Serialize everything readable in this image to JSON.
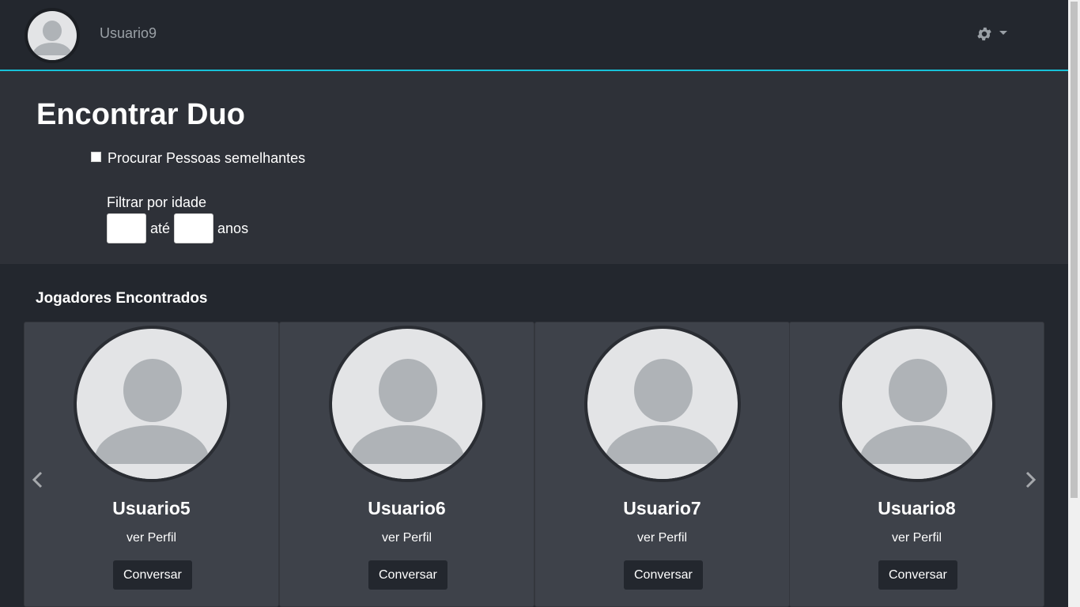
{
  "navbar": {
    "username": "Usuario9",
    "accent_color": "#17c1d8",
    "settings_icon": "gear-icon"
  },
  "filter": {
    "title": "Encontrar Duo",
    "similar_label": "Procurar Pessoas semelhantes",
    "similar_checked": false,
    "age_label": "Filtrar por idade",
    "age_from_value": "",
    "age_to_label": "até",
    "age_to_value": "",
    "age_unit": "anos"
  },
  "results": {
    "title": "Jogadores Encontrados",
    "cards": [
      {
        "name": "Usuario5",
        "profile_link": "ver Perfil",
        "button": "Conversar"
      },
      {
        "name": "Usuario6",
        "profile_link": "ver Perfil",
        "button": "Conversar"
      },
      {
        "name": "Usuario7",
        "profile_link": "ver Perfil",
        "button": "Conversar"
      },
      {
        "name": "Usuario8",
        "profile_link": "ver Perfil",
        "button": "Conversar"
      }
    ],
    "prev_icon": "chevron-left-icon",
    "next_icon": "chevron-right-icon"
  }
}
